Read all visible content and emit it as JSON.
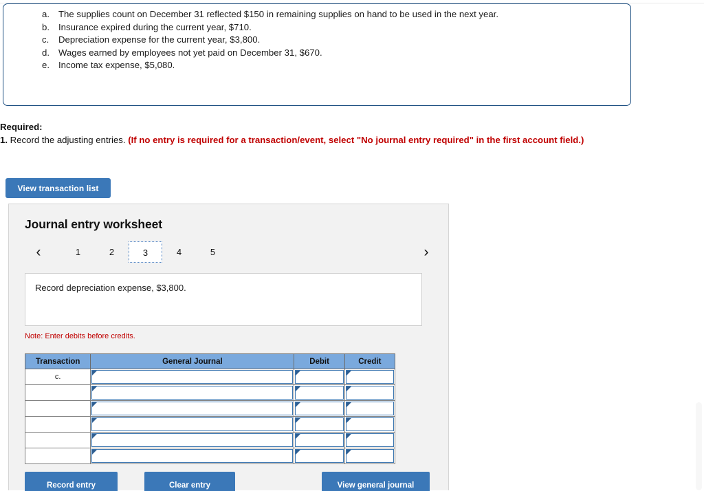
{
  "fact_box": {
    "items": [
      {
        "letter": "a.",
        "text": "The supplies count on December 31 reflected $150 in remaining supplies on hand to be used in the next year."
      },
      {
        "letter": "b.",
        "text": "Insurance expired during the current year, $710."
      },
      {
        "letter": "c.",
        "text": "Depreciation expense for the current year, $3,800."
      },
      {
        "letter": "d.",
        "text": "Wages earned by employees not yet paid on December 31, $670."
      },
      {
        "letter": "e.",
        "text": "Income tax expense, $5,080."
      }
    ]
  },
  "required": {
    "label": "Required:",
    "number": "1.",
    "instruction": " Record the adjusting entries. ",
    "parenthetical": "(If no entry is required for a transaction/event, select \"No journal entry required\" in the first account field.)"
  },
  "toolbar": {
    "view_transaction_list_label": "View transaction list"
  },
  "worksheet": {
    "title": "Journal entry worksheet",
    "pager": {
      "prev_icon": "chevron-left",
      "next_icon": "chevron-right",
      "pages": [
        "1",
        "2",
        "3",
        "4",
        "5"
      ],
      "active_page": "3"
    },
    "description": "Record depreciation expense, $3,800.",
    "note": "Note: Enter debits before credits.",
    "table": {
      "headers": [
        "Transaction",
        "General Journal",
        "Debit",
        "Credit"
      ],
      "rows": [
        {
          "transaction": "c.",
          "general_journal": "",
          "debit": "",
          "credit": ""
        },
        {
          "transaction": "",
          "general_journal": "",
          "debit": "",
          "credit": ""
        },
        {
          "transaction": "",
          "general_journal": "",
          "debit": "",
          "credit": ""
        },
        {
          "transaction": "",
          "general_journal": "",
          "debit": "",
          "credit": ""
        },
        {
          "transaction": "",
          "general_journal": "",
          "debit": "",
          "credit": ""
        },
        {
          "transaction": "",
          "general_journal": "",
          "debit": "",
          "credit": ""
        }
      ]
    },
    "actions": {
      "record_entry_label": "Record entry",
      "clear_entry_label": "Clear entry",
      "view_general_journal_label": "View general journal"
    }
  },
  "colors": {
    "accent_blue": "#3b78b8",
    "table_header_blue": "#7aa9dd",
    "alert_red": "#c00000",
    "box_border_blue": "#1d4f82",
    "panel_gray": "#f2f2f2"
  }
}
